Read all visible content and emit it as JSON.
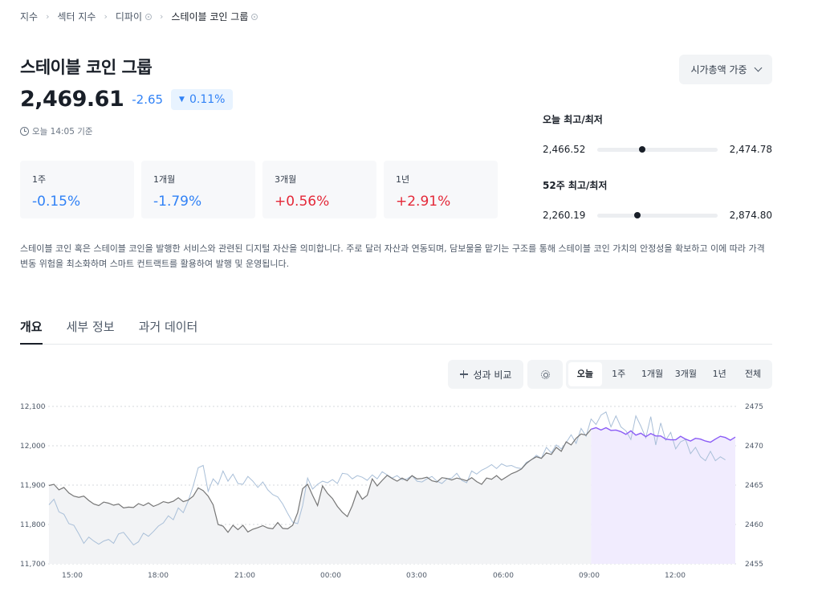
{
  "breadcrumb": {
    "items": [
      "지수",
      "섹터 지수",
      "디파이",
      "스테이블 코인 그룹"
    ]
  },
  "header": {
    "title": "스테이블 코인 그룹",
    "price": "2,469.61",
    "change": "-2.65",
    "change_pct": "0.11%",
    "as_of": "오늘 14:05 기준",
    "weight_label": "시가총액 가중"
  },
  "periods": [
    {
      "label": "1주",
      "value": "-0.15%"
    },
    {
      "label": "1개월",
      "value": "-1.79%"
    },
    {
      "label": "3개월",
      "value": "+0.56%"
    },
    {
      "label": "1년",
      "value": "+2.91%"
    }
  ],
  "ranges": {
    "today": {
      "title": "오늘 최고/최저",
      "low": "2,466.52",
      "high": "2,474.78",
      "position": 0.37
    },
    "week52": {
      "title": "52주 최고/최저",
      "low": "2,260.19",
      "high": "2,874.80",
      "position": 0.33
    }
  },
  "description": "스테이블 코인 혹은 스테이블 코인을 발행한 서비스와 관련된 디지털 자산을 의미합니다. 주로 달러 자산과 연동되며, 담보물을 맡기는 구조를 통해 스테이블 코인 가치의 안정성을 확보하고 이에 따라 가격 변동 위험을 최소화하며 스마트 컨트랙트를 활용하여 발행 및 운영됩니다.",
  "tabs": [
    "개요",
    "세부 정보",
    "과거 데이터"
  ],
  "toolbar": {
    "compare_label": "성과 비교",
    "ranges": [
      "오늘",
      "1주",
      "1개월",
      "3개월",
      "1년",
      "전체"
    ],
    "active_range": "오늘"
  },
  "colors": {
    "negative": "#3182f6",
    "positive": "#e42939",
    "accent_purple": "#8b5cf6",
    "compare_line": "#a9bfd8",
    "main_line": "#767676"
  },
  "chart_data": {
    "type": "line",
    "x_ticks": [
      "15:00",
      "18:00",
      "21:00",
      "00:00",
      "03:00",
      "06:00",
      "09:00",
      "12:00"
    ],
    "left_axis": {
      "ticks": [
        "12,100",
        "12,000",
        "11,900",
        "11,800",
        "11,700"
      ],
      "ylim": [
        11700,
        12100
      ]
    },
    "right_axis": {
      "ticks": [
        "2475",
        "2470",
        "2465",
        "2460",
        "2455"
      ],
      "ylim": [
        2455,
        2475
      ]
    },
    "highlight_from": "09:00",
    "series": [
      {
        "axis": "right",
        "values": [
          2462.5,
          2463.2,
          2461.6,
          2461.3,
          2460.1,
          2459.9,
          2458.8,
          2457.6,
          2458.4,
          2457.9,
          2457.5,
          2457.9,
          2458.1,
          2457.6,
          2458.8,
          2459.0,
          2458.2,
          2457.4,
          2457.8,
          2458.9,
          2458.5,
          2459.1,
          2459.8,
          2460.2,
          2461.1,
          2460.6,
          2462.1,
          2461.5,
          2463.0,
          2464.9,
          2467.2,
          2467.5,
          2464.2,
          2465.8,
          2465.1,
          2466.8,
          2465.5,
          2466.4,
          2465.2,
          2465.1,
          2466.1,
          2465.5,
          2464.7,
          2465.4,
          2464.4,
          2463.8,
          2463.5,
          2462.6,
          2461.4,
          2460.3,
          2460.1,
          2462.4,
          2465.9,
          2464.5,
          2465.1,
          2465.5,
          2465.3,
          2465.7,
          2465.2,
          2466.5,
          2466.4,
          2465.8,
          2466.2,
          2466.0,
          2465.6,
          2466.3,
          2465.8,
          2466.7,
          2466.3,
          2465.9,
          2466.2,
          2465.7,
          2465.8,
          2466.2,
          2465.5,
          2465.4,
          2465.8,
          2466.1,
          2465.5,
          2465.2,
          2465.8,
          2465.9,
          2466.5,
          2465.6,
          2465.3,
          2466.8,
          2466.4,
          2466.9,
          2467.2,
          2467.6,
          2467.1,
          2467.7,
          2467.4,
          2467.5,
          2467.2,
          2467.1,
          2467.9,
          2468.2,
          2468.8,
          2468.4,
          2469.8,
          2469.1,
          2470.1,
          2469.6,
          2470.4,
          2471.4,
          2470.3,
          2472.2,
          2471.2,
          2473.4,
          2472.7,
          2473.9,
          2474.3,
          2472.4,
          2473.8,
          2472.4,
          2471.9,
          2470.8,
          2473.8,
          2472.5,
          2471.0,
          2473.7,
          2470.1,
          2472.9,
          2470.7,
          2471.7,
          2469.6,
          2470.5,
          2470.8,
          2469.0,
          2469.8,
          2468.6,
          2468.1,
          2469.3,
          2468.1,
          2468.6,
          2468.2
        ]
      },
      {
        "axis": "left",
        "values": [
          11899,
          11902,
          11888,
          11894,
          11880,
          11872,
          11869,
          11872,
          11861,
          11852,
          11848,
          11857,
          11854,
          11849,
          11852,
          11842,
          11844,
          11843,
          11853,
          11848,
          11855,
          11846,
          11851,
          11858,
          11855,
          11859,
          11868,
          11858,
          11862,
          11872,
          11893,
          11886,
          11872,
          11850,
          11800,
          11796,
          11780,
          11798,
          11787,
          11798,
          11781,
          11788,
          11792,
          11797,
          11791,
          11789,
          11805,
          11790,
          11789,
          11798,
          11830,
          11891,
          11902,
          11874,
          11848,
          11898,
          11879,
          11866,
          11846,
          11831,
          11820,
          11848,
          11885,
          11864,
          11874,
          11916,
          11898,
          11912,
          11925,
          11917,
          11910,
          11918,
          11911,
          11924,
          11916,
          11917,
          11920,
          11911,
          11908,
          11919,
          11917,
          11913,
          11918,
          11915,
          11911,
          11919,
          11909,
          11902,
          11918,
          11915,
          11924,
          11913,
          11921,
          11929,
          11934,
          11941,
          11955,
          11965,
          11972,
          11968,
          11982,
          11978,
          11996,
          11986,
          12010,
          12002,
          12019,
          12030,
          12027,
          12042,
          12046,
          12040,
          12046,
          12039,
          12040,
          12036,
          12029,
          12038,
          12027,
          12032,
          12023,
          12031,
          12025,
          12025,
          12017,
          12015,
          12015,
          12024,
          12017,
          12012,
          12019,
          12017,
          12012,
          12009,
          12017,
          12024,
          12021,
          12014,
          12022
        ]
      }
    ]
  }
}
